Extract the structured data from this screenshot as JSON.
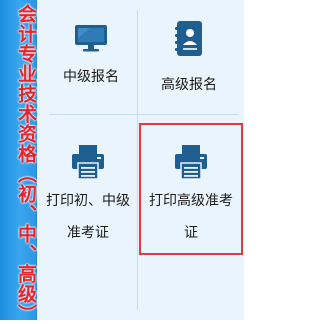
{
  "sidebar": {
    "title": "会计专业技术资格（初、中、高级）"
  },
  "tiles": [
    {
      "label": "中级报名",
      "icon": "monitor-icon"
    },
    {
      "label": "高级报名",
      "icon": "address-book-icon"
    },
    {
      "label_line1": "打印初、中级",
      "label_line2": "准考证",
      "icon": "printer-icon"
    },
    {
      "label_line1": "打印高级准考",
      "label_line2": "证",
      "icon": "printer-icon",
      "selected": true
    }
  ],
  "colors": {
    "sidebar_bg": "#2b97e6",
    "sidebar_text": "#e8222a",
    "icon_color": "#1f5f8f",
    "content_bg": "#e9f4fc",
    "selection_border": "#e03c3c"
  }
}
